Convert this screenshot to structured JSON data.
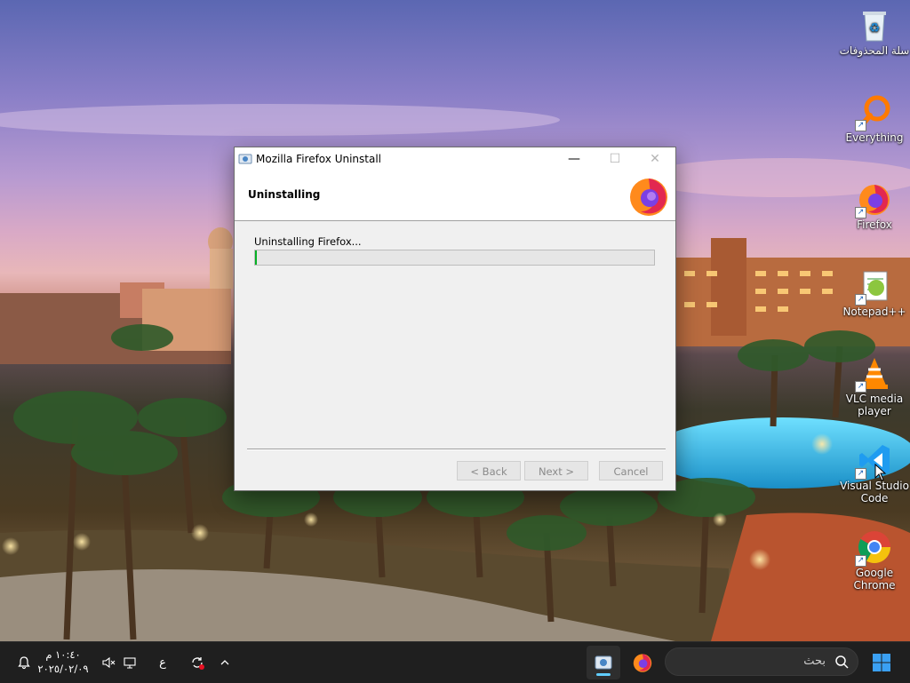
{
  "window": {
    "title": "Mozilla Firefox Uninstall",
    "icon": "uninstall-app-icon",
    "header_title": "Uninstalling",
    "header_logo": "firefox-logo-icon",
    "status_text": "Uninstalling Firefox...",
    "progress_percent": 0.5,
    "buttons": {
      "back": "< Back",
      "next": "Next >",
      "cancel": "Cancel"
    },
    "controls": {
      "minimize": "—",
      "maximize": "☐",
      "close": "✕"
    }
  },
  "desktop_icons": [
    {
      "label": "سلة المحذوفات",
      "icon": "recycle-bin-icon"
    },
    {
      "label": "Everything",
      "icon": "everything-search-icon"
    },
    {
      "label": "Firefox",
      "icon": "firefox-icon"
    },
    {
      "label": "Notepad++",
      "icon": "notepad-plus-plus-icon"
    },
    {
      "label": "VLC media player",
      "icon": "vlc-icon"
    },
    {
      "label": "Visual Studio Code",
      "icon": "vscode-icon"
    },
    {
      "label": "Google Chrome",
      "icon": "chrome-icon"
    }
  ],
  "taskbar": {
    "time": "١٠:٤٠ م",
    "date": "٢٠٢٥/٠٢/٠٩",
    "language": "ع",
    "search_placeholder": "بحث",
    "pinned": [
      "uninstaller-task-icon",
      "firefox-task-icon"
    ]
  },
  "colors": {
    "progress": "#06b025",
    "taskbar": "#1f1f1f",
    "accent": "#60cdff"
  }
}
